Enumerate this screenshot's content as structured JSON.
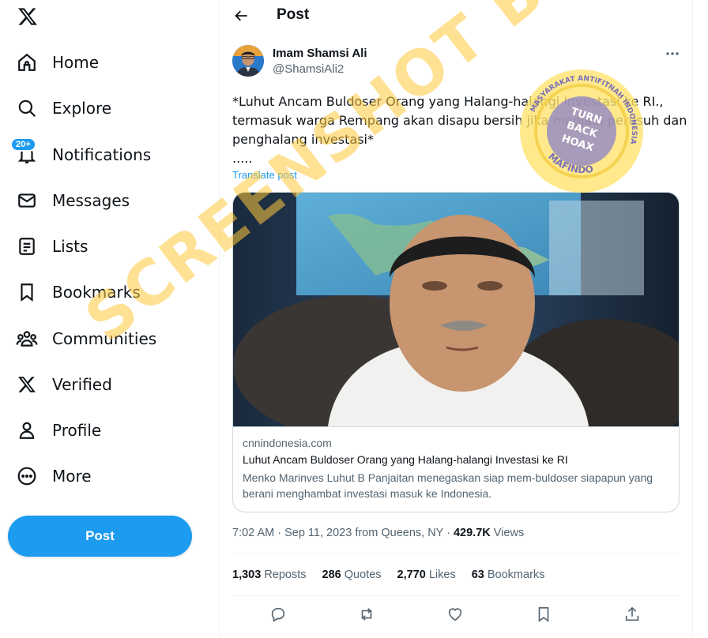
{
  "sidebar": {
    "logo": "x-logo-icon",
    "items": [
      {
        "label": "Home",
        "icon": "home-icon"
      },
      {
        "label": "Explore",
        "icon": "search-icon"
      },
      {
        "label": "Notifications",
        "icon": "bell-icon",
        "badge": "20+"
      },
      {
        "label": "Messages",
        "icon": "envelope-icon"
      },
      {
        "label": "Lists",
        "icon": "list-icon"
      },
      {
        "label": "Bookmarks",
        "icon": "bookmark-icon"
      },
      {
        "label": "Communities",
        "icon": "people-icon"
      },
      {
        "label": "Verified",
        "icon": "x-logo-icon"
      },
      {
        "label": "Profile",
        "icon": "person-icon"
      },
      {
        "label": "More",
        "icon": "more-circle-icon"
      }
    ],
    "post_button": "Post"
  },
  "header": {
    "title": "Post"
  },
  "post": {
    "author_name": "Imam Shamsi Ali",
    "author_handle": "@ShamsiAli2",
    "text_lines": [
      "*Luhut Ancam Buldoser Orang yang Halang-halangi Investasi ke RI.,",
      "termasuk warga Rempang akan disapu bersih jika menjadi perusuh dan",
      "penghalang investasi*",
      "....."
    ],
    "translate_label": "Translate post",
    "card": {
      "domain": "cnnindonesia.com",
      "title": "Luhut Ancam Buldoser Orang yang Halang-halangi Investasi ke RI",
      "description": "Menko Marinves Luhut B Panjaitan menegaskan siap mem-buldoser siapapun yang berani menghambat investasi masuk ke Indonesia."
    },
    "time": "7:02 AM",
    "date": "Sep 11, 2023",
    "location": "from Queens, NY",
    "views_count": "429.7K",
    "views_label": "Views",
    "stats": {
      "reposts_count": "1,303",
      "reposts_label": "Reposts",
      "quotes_count": "286",
      "quotes_label": "Quotes",
      "likes_count": "2,770",
      "likes_label": "Likes",
      "bookmarks_count": "63",
      "bookmarks_label": "Bookmarks"
    }
  },
  "watermark": {
    "screenshot_text": "SCREENSHOT BY",
    "stamp_top": "MASYARAKAT ANTIFITNAH INDONESIA",
    "stamp_center_lines": [
      "TURN",
      "BACK",
      "HOAX"
    ],
    "stamp_bottom": "MAFINDO"
  },
  "colors": {
    "accent": "#1d9bf0",
    "text_primary": "#0f1419",
    "text_secondary": "#536471",
    "border": "#cfd9de",
    "watermark_orange": "#ffc83c",
    "stamp_purple": "#8b7fc8"
  }
}
